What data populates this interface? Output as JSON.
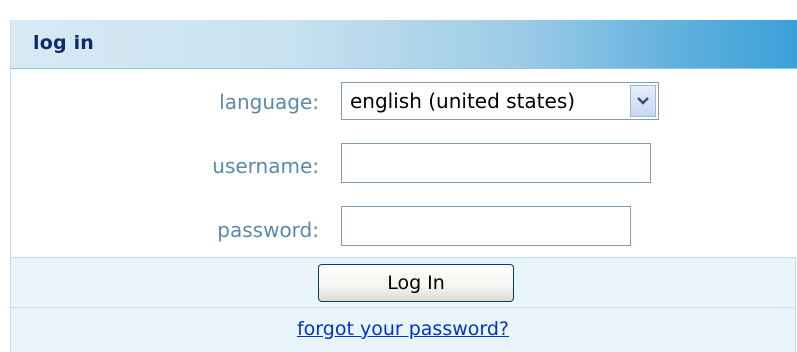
{
  "header": {
    "title": "log in"
  },
  "form": {
    "language": {
      "label": "language:",
      "selected_value": "english (united states)",
      "arrow_icon": "chevron-down-icon"
    },
    "username": {
      "label": "username:",
      "value": ""
    },
    "password": {
      "label": "password:",
      "value": ""
    }
  },
  "actions": {
    "login_label": "Log In",
    "forgot_label": "forgot your password?"
  },
  "colors": {
    "header_text": "#0f2a6b",
    "label_text": "#5a8aa8",
    "link": "#0033cc",
    "row_background": "#e9f4fb"
  }
}
